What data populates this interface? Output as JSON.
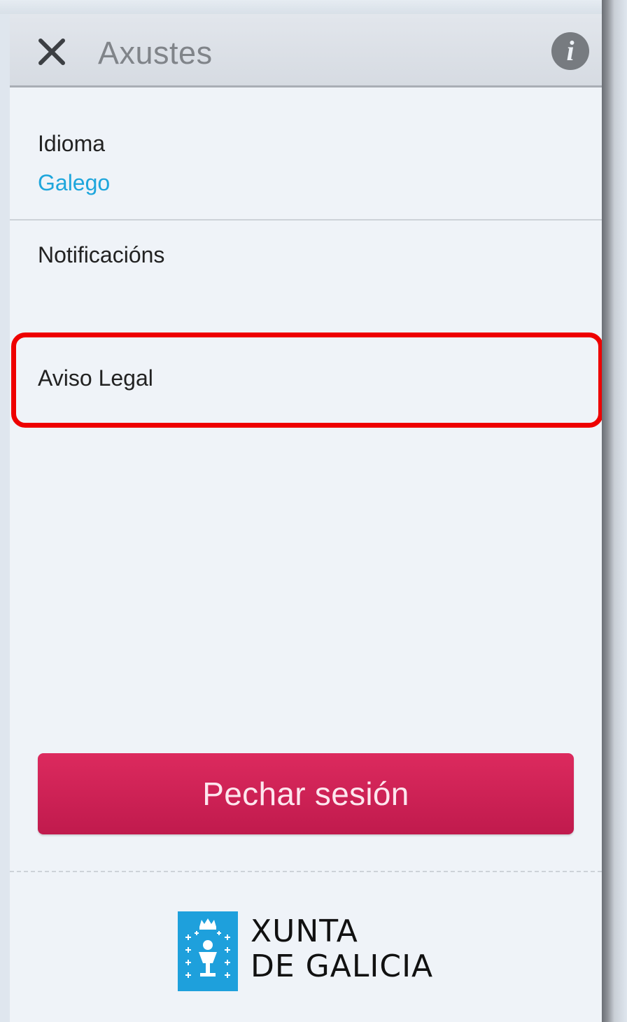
{
  "header": {
    "title": "Axustes",
    "close_icon": "close-icon",
    "info_icon": "info-icon",
    "info_glyph": "i"
  },
  "settings": {
    "language": {
      "label": "Idioma",
      "value": "Galego"
    },
    "notifications": {
      "label": "Notificacións"
    },
    "legal": {
      "label": "Aviso Legal"
    }
  },
  "logout": {
    "label": "Pechar sesión"
  },
  "footer": {
    "logo_line1": "XUNTA",
    "logo_line2": "DE GALICIA"
  },
  "colors": {
    "accent_link": "#1ea6dc",
    "logout_button": "#d21f55",
    "highlight": "#ee0000",
    "logo_blue": "#1ea0dc"
  }
}
